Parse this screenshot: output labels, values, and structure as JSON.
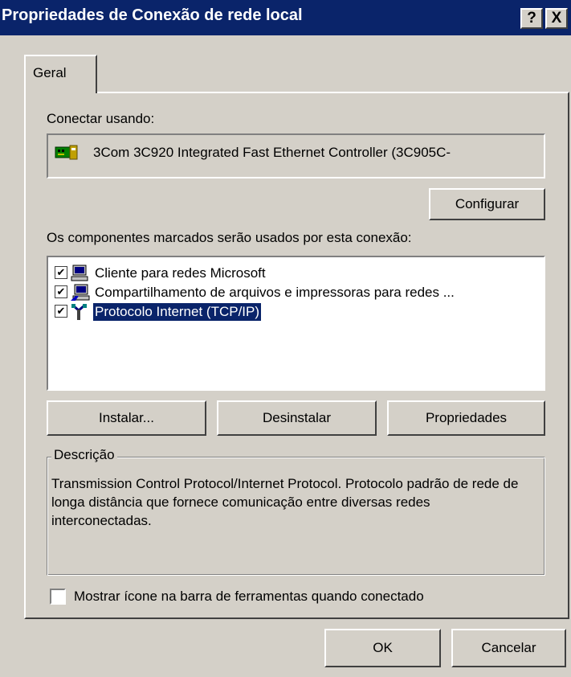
{
  "window": {
    "title": "Propriedades de Conexão de rede local",
    "help_button": "?",
    "close_button": "X"
  },
  "tabs": [
    {
      "label": "Geral"
    }
  ],
  "connect_using": {
    "label": "Conectar usando:",
    "adapter": "3Com 3C920 Integrated Fast Ethernet Controller (3C905C-",
    "adapter_icon": "network-card-icon",
    "configure_button": "Configurar"
  },
  "components": {
    "label": "Os componentes marcados serão usados por esta conexão:",
    "items": [
      {
        "label": "Cliente para redes Microsoft",
        "checked": true,
        "icon": "computer-icon",
        "selected": false
      },
      {
        "label": "Compartilhamento de arquivos e impressoras para redes ...",
        "checked": true,
        "icon": "shared-computer-icon",
        "selected": false
      },
      {
        "label": "Protocolo Internet (TCP/IP)",
        "checked": true,
        "icon": "protocol-icon",
        "selected": true
      }
    ]
  },
  "actions": {
    "install": "Instalar...",
    "uninstall": "Desinstalar",
    "properties": "Propriedades"
  },
  "description": {
    "legend": "Descrição",
    "text": "Transmission Control Protocol/Internet Protocol. Protocolo padrão de rede de longa distância que fornece comunicação entre diversas redes interconectadas."
  },
  "show_icon": {
    "label": "Mostrar ícone na barra de ferramentas quando conectado",
    "checked": false
  },
  "footer": {
    "ok": "OK",
    "cancel": "Cancelar"
  },
  "colors": {
    "title_bar": "#0a246a",
    "face": "#d4d0c8",
    "selection": "#0a246a"
  }
}
